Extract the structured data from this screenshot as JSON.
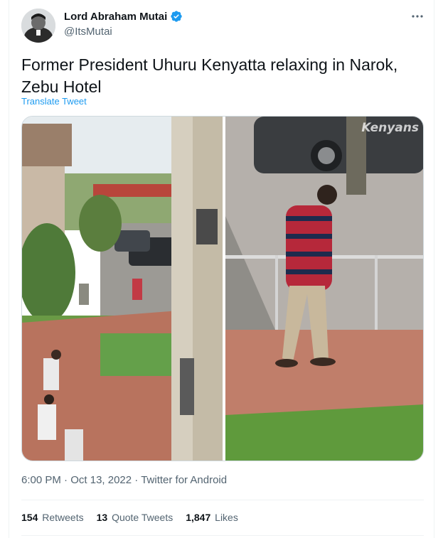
{
  "author": {
    "display_name": "Lord Abraham Mutai",
    "handle": "@ItsMutai"
  },
  "tweet": {
    "text": "Former President Uhuru Kenyatta relaxing in Narok, Zebu Hotel",
    "translate_label": "Translate Tweet",
    "time": "6:00 PM",
    "date": "Oct 13, 2022",
    "source": "Twitter for Android",
    "separator": "·"
  },
  "media": {
    "watermark": "Kenyans"
  },
  "stats": {
    "retweets_count": "154",
    "retweets_label": "Retweets",
    "quotes_count": "13",
    "quotes_label": "Quote Tweets",
    "likes_count": "1,847",
    "likes_label": "Likes"
  },
  "colors": {
    "accent": "#1d9bf0",
    "text": "#0f1419",
    "secondary": "#536471"
  },
  "icons": [
    "verified-badge-icon",
    "more-options-icon"
  ]
}
